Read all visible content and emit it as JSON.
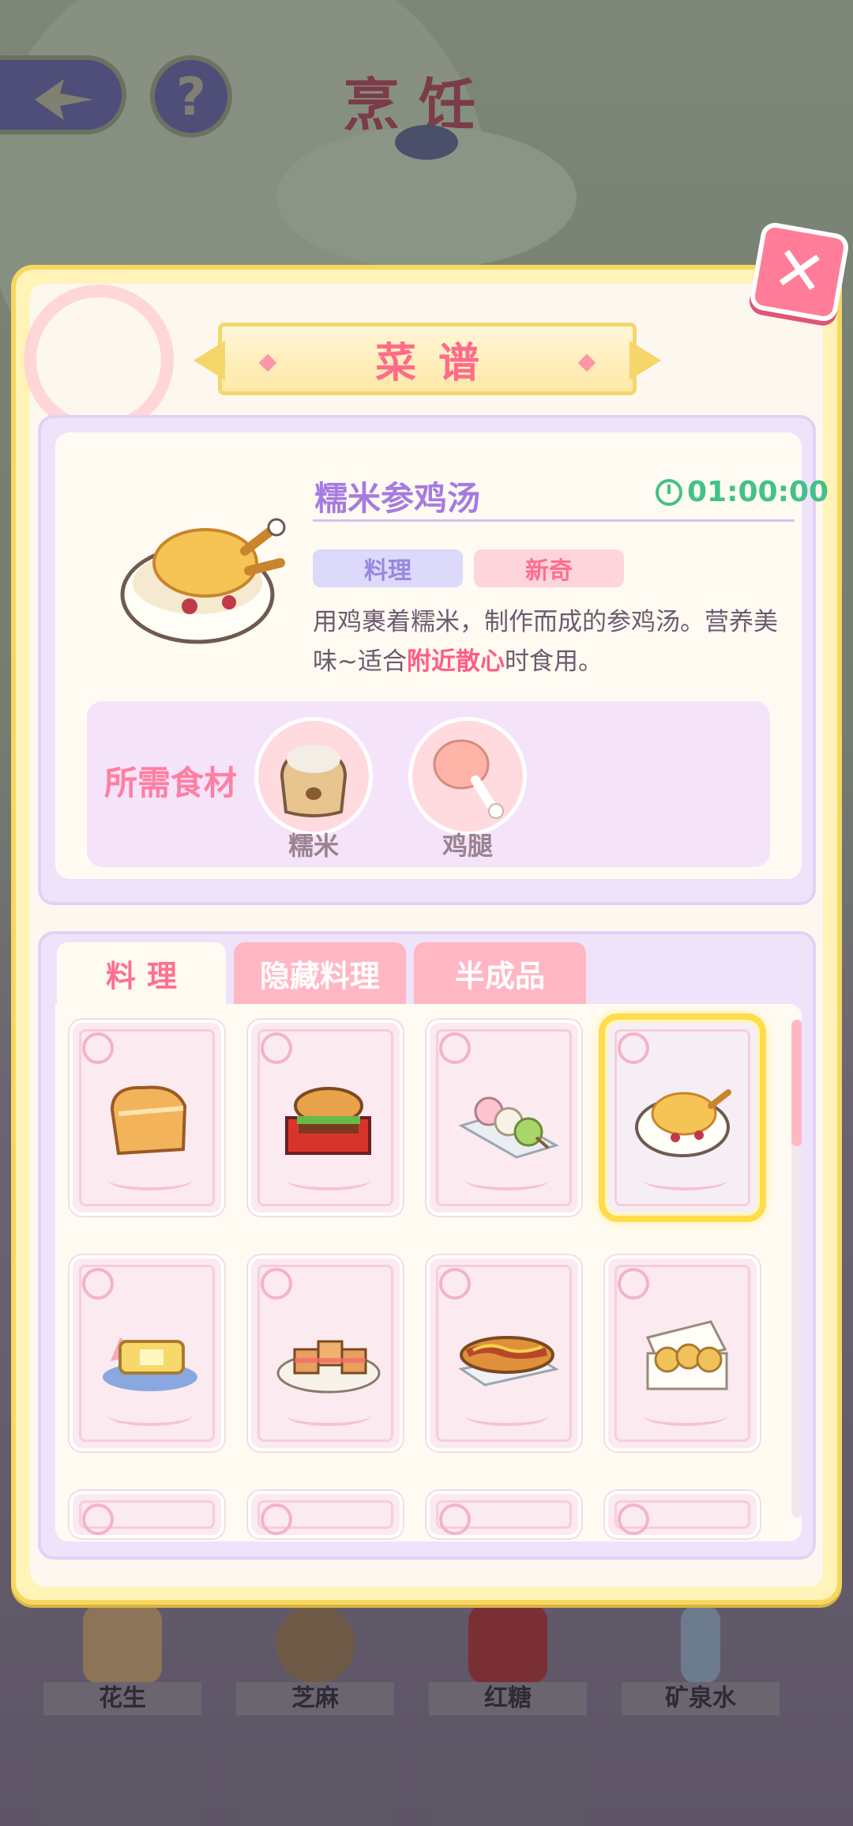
{
  "scene": {
    "title": "烹饪",
    "back_icon": "arrow-left-icon",
    "help_label": "?"
  },
  "shelf": {
    "row1": [
      "花生",
      "芝麻",
      "红糖",
      "矿泉水"
    ]
  },
  "dialog": {
    "title": "菜谱",
    "close_label": "✕",
    "recipe": {
      "name": "糯米参鸡汤",
      "timer": "01:00:00",
      "tag_type": "料理",
      "tag_new": "新奇",
      "desc_part1": "用鸡裹着糯米，制作而成的参鸡汤。营养美味~适合",
      "desc_highlight": "附近散心",
      "desc_part2": "时食用。",
      "ingredients_label": "所需食材",
      "ingredients": [
        "糯米",
        "鸡腿"
      ]
    },
    "tabs": [
      "料理",
      "隐藏料理",
      "半成品"
    ],
    "cards": [
      {
        "food": "bread-icon"
      },
      {
        "food": "burger-icon"
      },
      {
        "food": "dango-icon"
      },
      {
        "food": "chicken-soup-icon",
        "selected": true
      },
      {
        "food": "toast-icon"
      },
      {
        "food": "sandwich-plate-icon"
      },
      {
        "food": "hotdog-icon"
      },
      {
        "food": "buns-box-icon"
      }
    ]
  },
  "colors": {
    "accent_pink": "#ff6f8e",
    "accent_purple": "#a67be0",
    "timer_green": "#44c08a",
    "selection_gold": "#ffdc4a"
  }
}
